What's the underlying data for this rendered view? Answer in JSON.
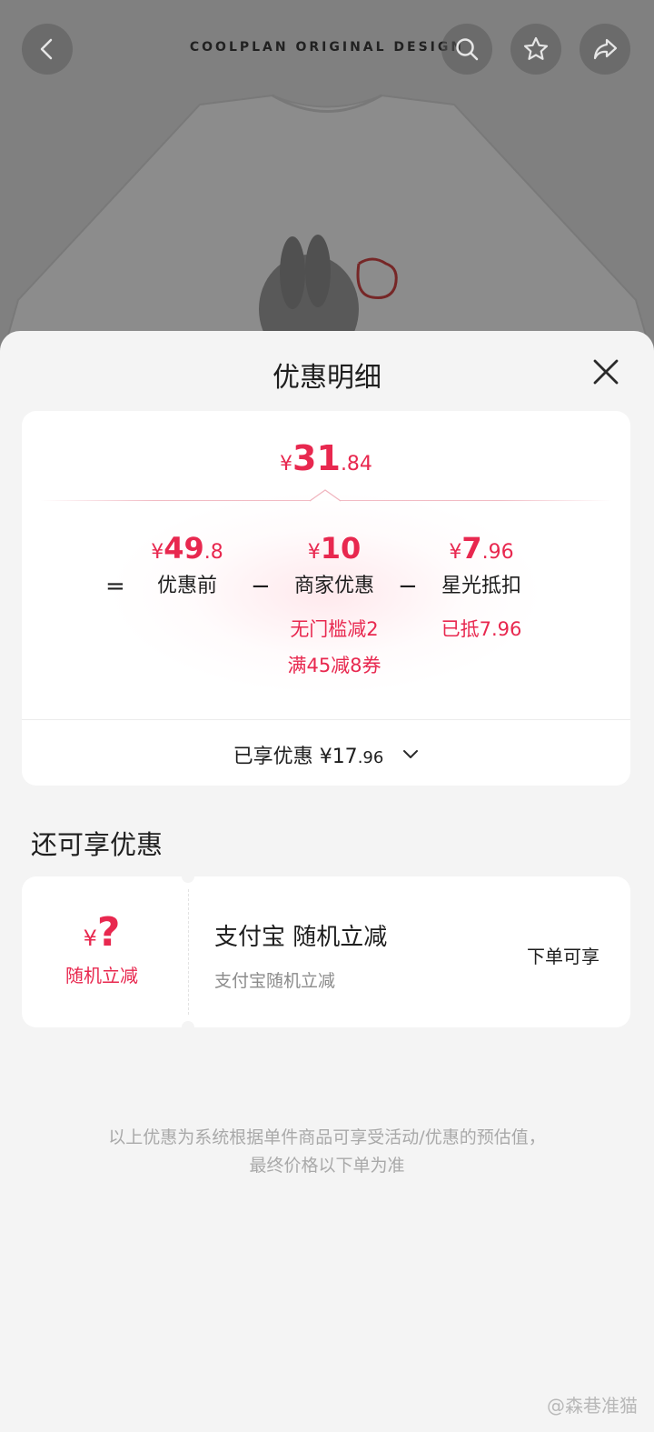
{
  "background": {
    "brand_text": "COOLPLAN ORIGINAL DESIGN"
  },
  "sheet": {
    "title": "优惠明细",
    "final_price": {
      "yen": "¥",
      "int": "31",
      "dec": ".84"
    },
    "breakdown": [
      {
        "yen": "¥",
        "int": "49",
        "dec": ".8",
        "label": "优惠前",
        "details": []
      },
      {
        "yen": "¥",
        "int": "10",
        "dec": "",
        "label": "商家优惠",
        "details": [
          "无门槛减2",
          "满45减8券"
        ]
      },
      {
        "yen": "¥",
        "int": "7",
        "dec": ".96",
        "label": "星光抵扣",
        "details": [
          "已抵7.96"
        ]
      }
    ],
    "operators": [
      "=",
      "−",
      "−"
    ],
    "enjoyed": {
      "label": "已享优惠",
      "yen": "¥",
      "int": "17",
      "dec": ".96"
    },
    "more_title": "还可享优惠",
    "coupon": {
      "yen": "¥",
      "amount": "?",
      "left_label": "随机立减",
      "title": "支付宝 随机立减",
      "desc": "支付宝随机立减",
      "action": "下单可享"
    },
    "disclaimer_line1": "以上优惠为系统根据单件商品可享受活动/优惠的预估值，",
    "disclaimer_line2": "最终价格以下单为准"
  },
  "watermark": "@森巷准猫",
  "colors": {
    "accent": "#e8284f",
    "sheet_bg": "#f4f4f4",
    "card_bg": "#ffffff"
  },
  "icons": [
    "back-icon",
    "search-icon",
    "star-icon",
    "share-icon",
    "close-icon",
    "chevron-down-icon"
  ]
}
